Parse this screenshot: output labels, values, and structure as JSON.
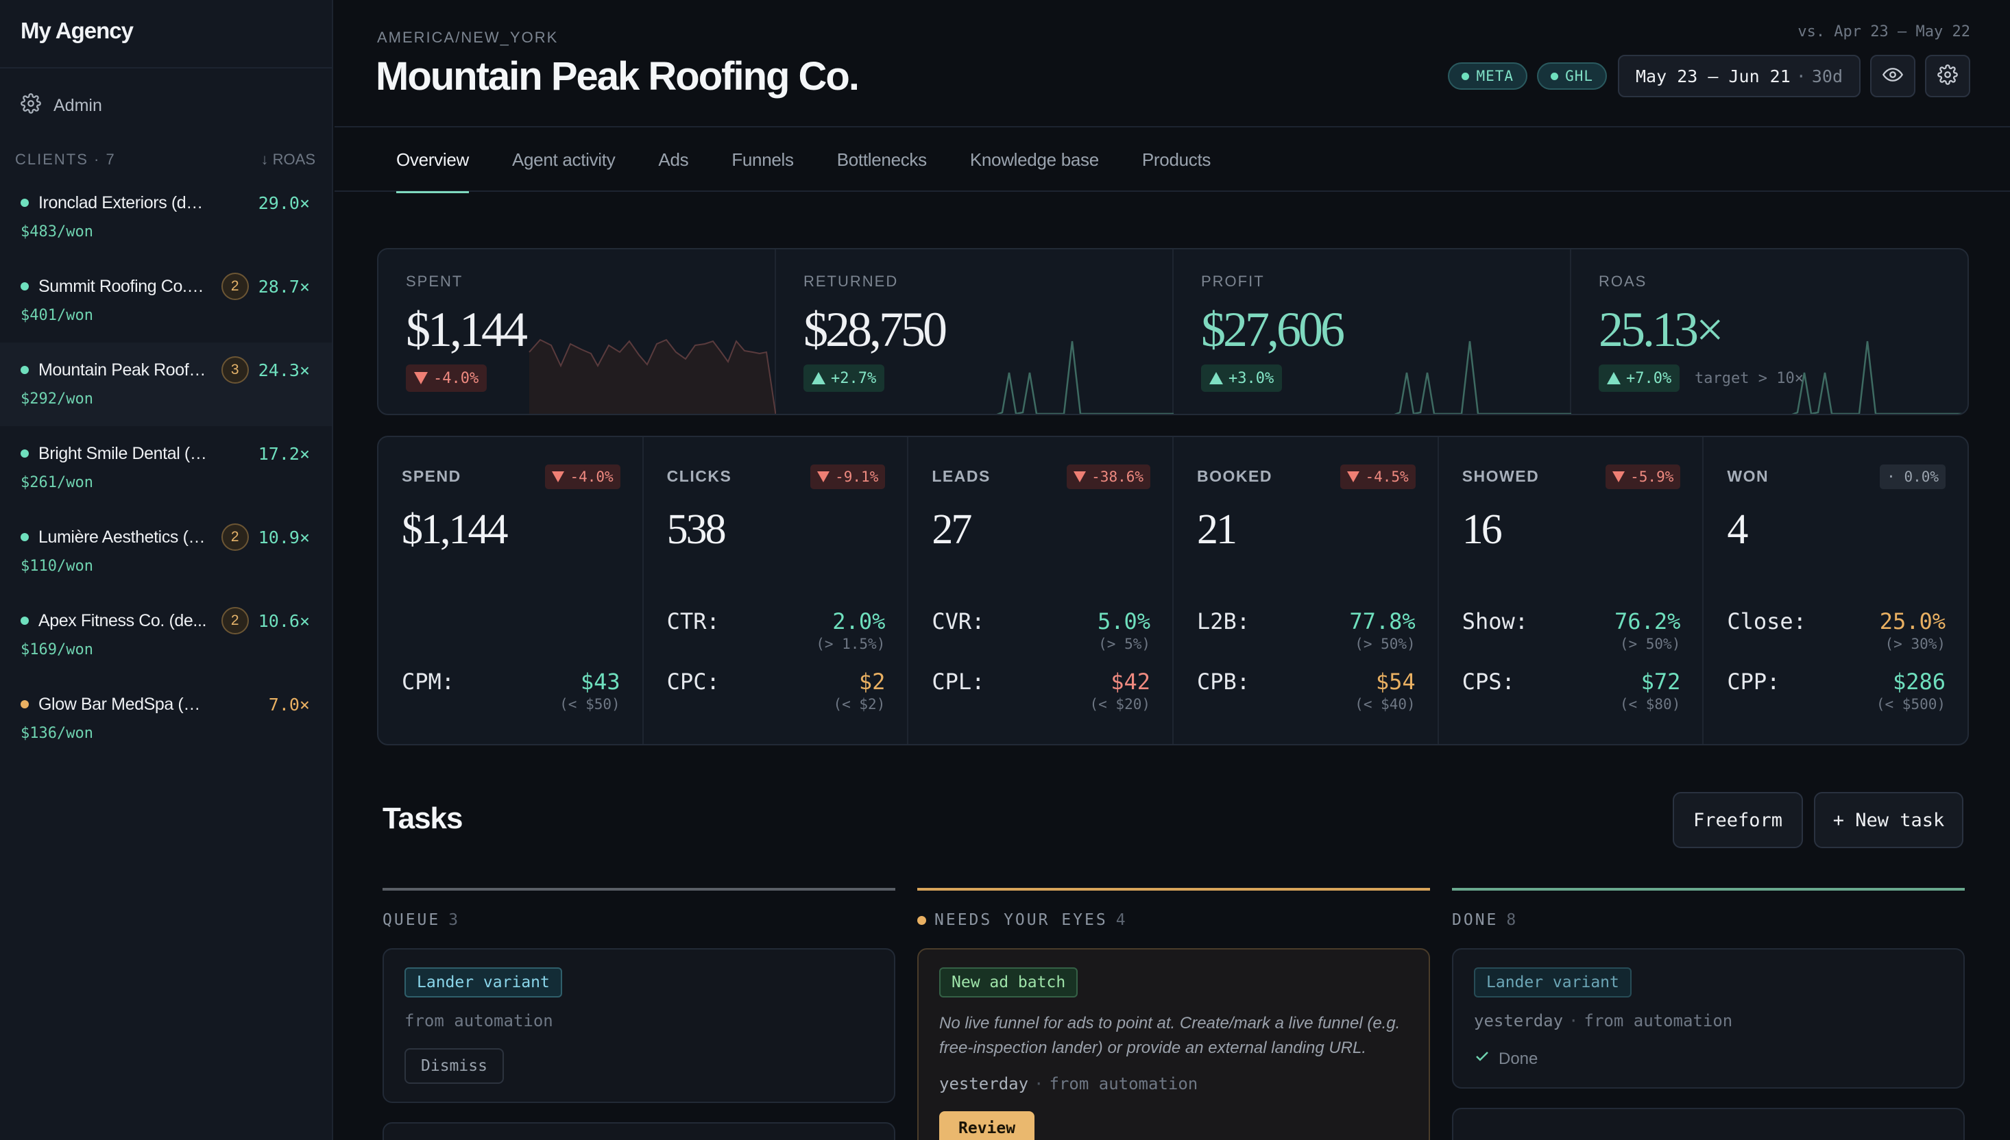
{
  "sidebar": {
    "brand": "My Agency",
    "admin_label": "Admin",
    "clients_header": "CLIENTS · 7",
    "sort_label": "↓ ROAS",
    "clients": [
      {
        "name": "Ironclad Exteriors (demo)",
        "badge": "",
        "roas": "29.0×",
        "won": "$483/won",
        "dot_color": "#6fe0be",
        "roas_color": "#6fe0be"
      },
      {
        "name": "Summit Roofing Co. (...",
        "badge": "2",
        "roas": "28.7×",
        "won": "$401/won",
        "dot_color": "#6fe0be",
        "roas_color": "#6fe0be"
      },
      {
        "name": "Mountain Peak Roofin...",
        "badge": "3",
        "roas": "24.3×",
        "won": "$292/won",
        "dot_color": "#6fe0be",
        "roas_color": "#6fe0be"
      },
      {
        "name": "Bright Smile Dental (demo)",
        "badge": "",
        "roas": "17.2×",
        "won": "$261/won",
        "dot_color": "#6fe0be",
        "roas_color": "#6fe0be"
      },
      {
        "name": "Lumière Aesthetics (d...",
        "badge": "2",
        "roas": "10.9×",
        "won": "$110/won",
        "dot_color": "#6fe0be",
        "roas_color": "#6fe0be"
      },
      {
        "name": "Apex Fitness Co. (de...",
        "badge": "2",
        "roas": "10.6×",
        "won": "$169/won",
        "dot_color": "#6fe0be",
        "roas_color": "#6fe0be"
      },
      {
        "name": "Glow Bar MedSpa (demo)",
        "badge": "",
        "roas": "7.0×",
        "won": "$136/won",
        "dot_color": "#e9b062",
        "roas_color": "#e9b062"
      }
    ]
  },
  "header": {
    "timezone": "AMERICA/NEW_YORK",
    "title": "Mountain Peak Roofing Co.",
    "compare": "vs. Apr 23 – May 22",
    "pill_meta": "META",
    "pill_ghl": "GHL",
    "date_range": "May 23 – Jun 21",
    "date_sep": "·",
    "date_days": "30d"
  },
  "icons": {
    "admin": "gear-icon",
    "visibility": "eye-icon",
    "settings": "gear-icon",
    "done": "check-icon"
  },
  "tabs": [
    "Overview",
    "Agent activity",
    "Ads",
    "Funnels",
    "Bottlenecks",
    "Knowledge base",
    "Products"
  ],
  "active_tab": "Overview",
  "kpis": [
    {
      "label": "SPENT",
      "value": "$1,144",
      "change": "-4.0%",
      "direction": "down",
      "value_color": "#eef0f3"
    },
    {
      "label": "RETURNED",
      "value": "$28,750",
      "change": "+2.7%",
      "direction": "up",
      "value_color": "#eef0f3"
    },
    {
      "label": "PROFIT",
      "value": "$27,606",
      "change": "+3.0%",
      "direction": "up",
      "value_color": "#7fd9bf"
    },
    {
      "label": "ROAS",
      "value": "25.13×",
      "change": "+7.0%",
      "direction": "up",
      "value_color": "#7fd9bf",
      "target": "target > 10×"
    }
  ],
  "metrics": [
    {
      "label": "SPEND",
      "change": "-4.0%",
      "dir": "down",
      "value": "$1,144",
      "l1": null,
      "l2": {
        "k": "CPM:",
        "v": "$43",
        "t": "(< $50)",
        "c": "#6fe0be"
      }
    },
    {
      "label": "CLICKS",
      "change": "-9.1%",
      "dir": "down",
      "value": "538",
      "l1": {
        "k": "CTR:",
        "v": "2.0%",
        "t": "(> 1.5%)",
        "c": "#6fe0be"
      },
      "l2": {
        "k": "CPC:",
        "v": "$2",
        "t": "(< $2)",
        "c": "#e9b062"
      }
    },
    {
      "label": "LEADS",
      "change": "-38.6%",
      "dir": "down",
      "value": "27",
      "l1": {
        "k": "CVR:",
        "v": "5.0%",
        "t": "(> 5%)",
        "c": "#6fe0be"
      },
      "l2": {
        "k": "CPL:",
        "v": "$42",
        "t": "(< $20)",
        "c": "#ef8a80"
      }
    },
    {
      "label": "BOOKED",
      "change": "-4.5%",
      "dir": "down",
      "value": "21",
      "l1": {
        "k": "L2B:",
        "v": "77.8%",
        "t": "(> 50%)",
        "c": "#6fe0be"
      },
      "l2": {
        "k": "CPB:",
        "v": "$54",
        "t": "(< $40)",
        "c": "#e9b062"
      }
    },
    {
      "label": "SHOWED",
      "change": "-5.9%",
      "dir": "down",
      "value": "16",
      "l1": {
        "k": "Show:",
        "v": "76.2%",
        "t": "(> 50%)",
        "c": "#6fe0be"
      },
      "l2": {
        "k": "CPS:",
        "v": "$72",
        "t": "(< $80)",
        "c": "#6fe0be"
      }
    },
    {
      "label": "WON",
      "change": "· 0.0%",
      "dir": "flat",
      "value": "4",
      "l1": {
        "k": "Close:",
        "v": "25.0%",
        "t": "(> 30%)",
        "c": "#e9b062"
      },
      "l2": {
        "k": "CPP:",
        "v": "$286",
        "t": "(< $500)",
        "c": "#6fe0be"
      }
    }
  ],
  "tasks": {
    "title": "Tasks",
    "freeform": "Freeform",
    "new_task": "+ New task",
    "queue": {
      "label": "QUEUE",
      "count": "3",
      "card": {
        "tag": "Lander variant",
        "source": "from automation",
        "action": "Dismiss"
      }
    },
    "needs": {
      "label": "NEEDS YOUR EYES",
      "count": "4",
      "card": {
        "tag": "New ad batch",
        "description": "No live funnel for ads to point at. Create/mark a live funnel (e.g. free-inspection lander) or provide an external landing URL.",
        "when": "yesterday",
        "source": "from automation",
        "action": "Review"
      }
    },
    "done": {
      "label": "DONE",
      "count": "8",
      "card": {
        "tag": "Lander variant",
        "when": "yesterday",
        "source": "from automation",
        "status": "Done"
      }
    }
  },
  "bullet": "·"
}
